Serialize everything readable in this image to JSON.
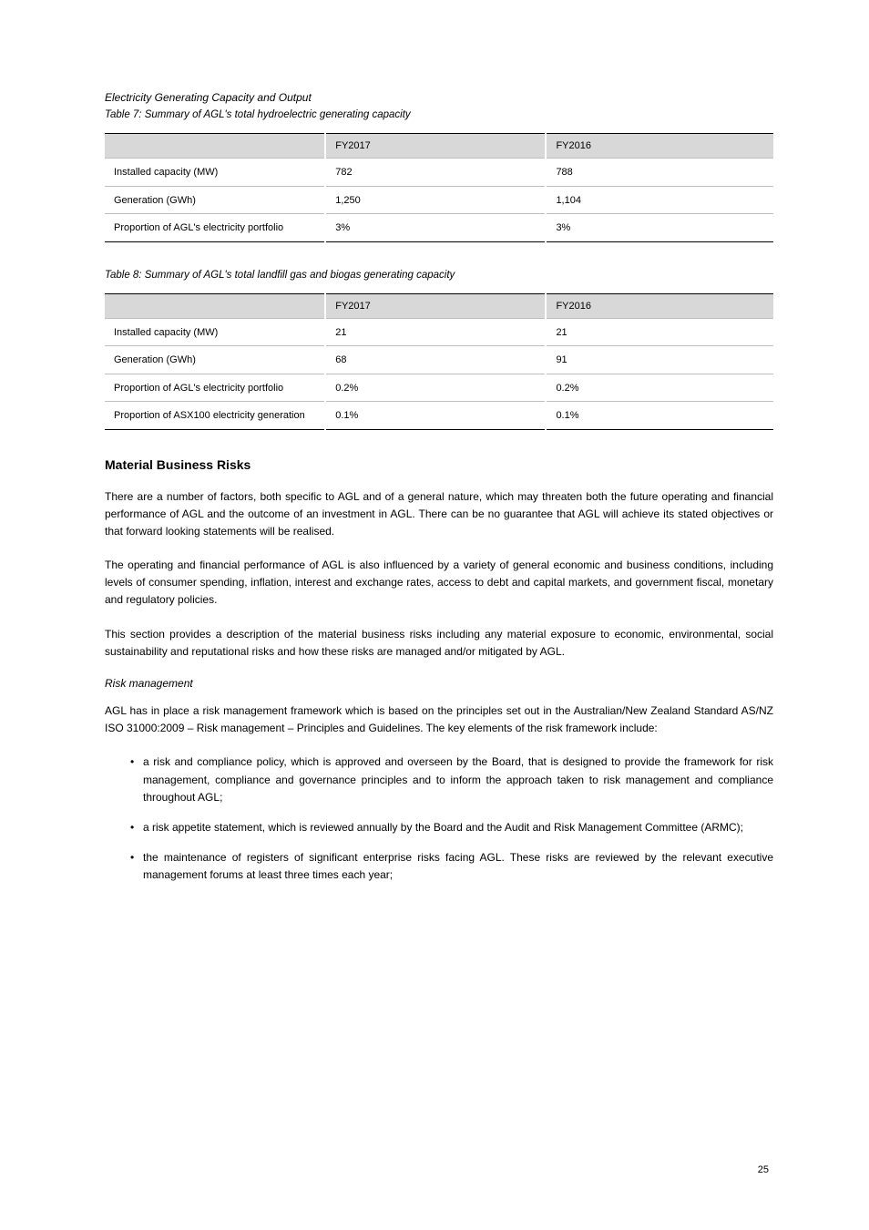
{
  "headings": {
    "electricity": "Electricity Generating Capacity and Output",
    "table7": "Table 7: Summary of AGL's total hydroelectric generating capacity",
    "table8": "Table 8: Summary of AGL's total landfill gas and biogas generating capacity",
    "materialBusinessRisks": "Material Business Risks",
    "riskManagement": "Risk management"
  },
  "table7": {
    "headers": [
      "",
      "FY2017",
      "FY2016"
    ],
    "rows": [
      [
        "Installed capacity (MW)",
        "782",
        "788"
      ],
      [
        "Generation (GWh)",
        "1,250",
        "1,104"
      ],
      [
        "Proportion of AGL's electricity portfolio",
        "3%",
        "3%"
      ]
    ]
  },
  "table8": {
    "headers": [
      "",
      "FY2017",
      "FY2016"
    ],
    "rows": [
      [
        "Installed capacity (MW)",
        "21",
        "21"
      ],
      [
        "Generation (GWh)",
        "68",
        "91"
      ],
      [
        "Proportion of AGL's electricity portfolio",
        "0.2%",
        "0.2%"
      ],
      [
        "Proportion of ASX100 electricity generation",
        "0.1%",
        "0.1%"
      ]
    ]
  },
  "paragraphs": {
    "p1": "There are a number of factors, both specific to AGL and of a general nature, which may threaten both the future operating and financial performance of AGL and the outcome of an investment in AGL. There can be no guarantee that AGL will achieve its stated objectives or that forward looking statements will be realised.",
    "p2": "The operating and financial performance of AGL is also influenced by a variety of general economic and business conditions, including levels of consumer spending, inflation, interest and exchange rates, access to debt and capital markets, and government fiscal, monetary and regulatory policies.",
    "p3": "This section provides a description of the material business risks including any material exposure to economic, environmental, social sustainability and reputational risks and how these risks are managed and/or mitigated by AGL.",
    "p4": "AGL has in place a risk management framework which is based on the principles set out in the Australian/New Zealand Standard AS/NZ ISO 31000:2009 – Risk management – Principles and Guidelines. The key elements of the risk framework include:"
  },
  "bullets": [
    "a risk and compliance policy, which is approved and overseen by the Board, that is designed to provide the framework for risk management, compliance and governance principles and to inform the approach taken to risk management and compliance throughout AGL;",
    "a risk appetite statement, which is reviewed annually by the Board and the Audit and Risk Management Committee (ARMC);",
    "the maintenance of registers of significant enterprise risks facing AGL. These risks are reviewed by the relevant executive management forums at least three times each year;"
  ],
  "pageNumber": "25"
}
